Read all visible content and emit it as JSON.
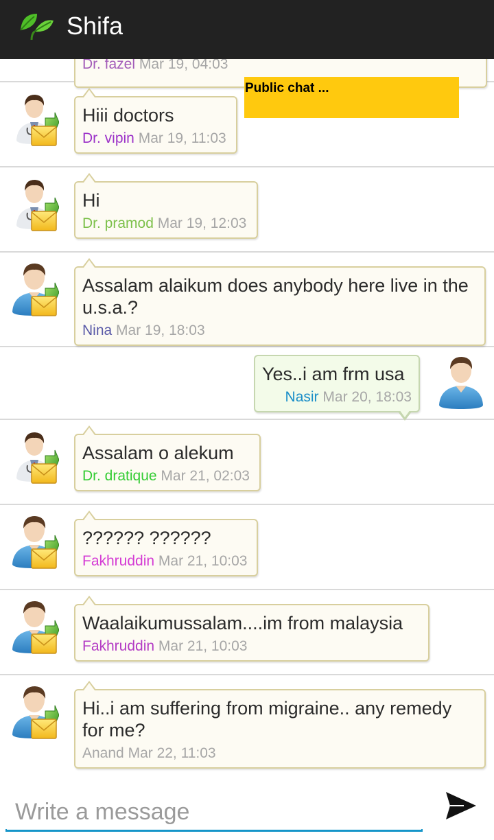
{
  "app": {
    "title": "Shifa",
    "icon": "leaf-icon"
  },
  "overlay": {
    "label": "Public chat ..."
  },
  "partial_message": {
    "sender": "Dr. fazel",
    "time": "Mar 19, 04:03",
    "sender_color": "#a25ab8"
  },
  "messages": [
    {
      "text": "Hiii doctors",
      "sender": "Dr. vipin",
      "time": "Mar 19, 11:03",
      "sender_color": "#9b30c8",
      "avatar": "doctor-avatar-icon",
      "mine": false
    },
    {
      "text": "Hi",
      "sender": "Dr. pramod",
      "time": "Mar 19, 12:03",
      "sender_color": "#7cc04a",
      "avatar": "doctor-avatar-icon",
      "mine": false
    },
    {
      "text": "Assalam alaikum does anybody here live in the u.s.a.?",
      "sender": "Nina",
      "time": "Mar 19, 18:03",
      "sender_color": "#5a5aa8",
      "avatar": "user-avatar-icon",
      "mine": false
    },
    {
      "text": "Yes..i am frm usa",
      "sender": "Nasir",
      "time": "Mar 20, 18:03",
      "sender_color": "#1a8ec8",
      "avatar": "user-avatar-icon",
      "mine": true
    },
    {
      "text": "Assalam o alekum",
      "sender": "Dr. dratique",
      "time": "Mar 21, 02:03",
      "sender_color": "#33cc33",
      "avatar": "doctor-avatar-icon",
      "mine": false
    },
    {
      "text": "?????? ??????",
      "sender": "Fakhruddin",
      "time": "Mar 21, 10:03",
      "sender_color": "#d43bd4",
      "avatar": "user-avatar-icon",
      "mine": false
    },
    {
      "text": "Waalaikumussalam....im from malaysia",
      "sender": "Fakhruddin",
      "time": "Mar 21, 10:03",
      "sender_color": "#b33bc4",
      "avatar": "user-avatar-icon",
      "mine": false
    },
    {
      "text": "Hi..i am suffering from migraine.. any remedy for me?",
      "sender": "Anand",
      "time": "Mar 22, 11:03",
      "sender_color": "#b0b0b0",
      "avatar": "user-avatar-icon",
      "mine": false
    }
  ],
  "composer": {
    "placeholder": "Write a message",
    "send_icon": "send-icon"
  },
  "colors": {
    "actionbar": "#222222",
    "overlay": "#ffc90e",
    "input_accent": "#1595c9"
  }
}
